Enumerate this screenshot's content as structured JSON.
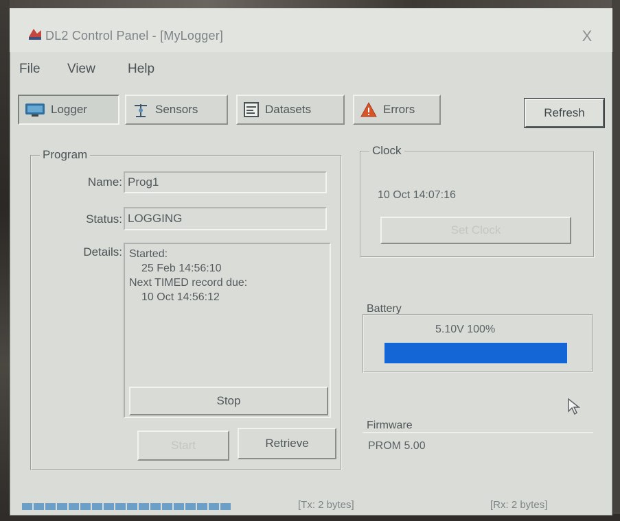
{
  "window": {
    "title": "DL2 Control Panel - [MyLogger]",
    "close_glyph": "X"
  },
  "menu": {
    "items": [
      "File",
      "View",
      "Help"
    ]
  },
  "toolbar": {
    "tabs": [
      {
        "label": "Logger",
        "icon": "monitor-icon",
        "active": true
      },
      {
        "label": "Sensors",
        "icon": "sensor-icon",
        "active": false
      },
      {
        "label": "Datasets",
        "icon": "dataset-icon",
        "active": false
      },
      {
        "label": "Errors",
        "icon": "warning-icon",
        "active": false
      }
    ],
    "refresh_label": "Refresh"
  },
  "program": {
    "group_label": "Program",
    "name_label": "Name:",
    "name_value": "Prog1",
    "status_label": "Status:",
    "status_value": "LOGGING",
    "details_label": "Details:",
    "details_lines": [
      "Started:",
      "   25 Feb 14:56:10",
      "Next TIMED record due:",
      "   10 Oct 14:56:12"
    ],
    "stop_label": "Stop",
    "start_label": "Start",
    "retrieve_label": "Retrieve"
  },
  "clock": {
    "group_label": "Clock",
    "value": "10 Oct 14:07:16",
    "set_clock_label": "Set Clock"
  },
  "battery": {
    "label": "Battery",
    "value": "5.10V  100%",
    "level_percent": 100,
    "bar_color": "#1466d6"
  },
  "firmware": {
    "label": "Firmware",
    "value": "PROM 5.00"
  },
  "statusbar": {
    "rx_text": "[Tx: 2 bytes]",
    "tx_text": "[Rx: 2 bytes]",
    "progress_segments": 18
  }
}
